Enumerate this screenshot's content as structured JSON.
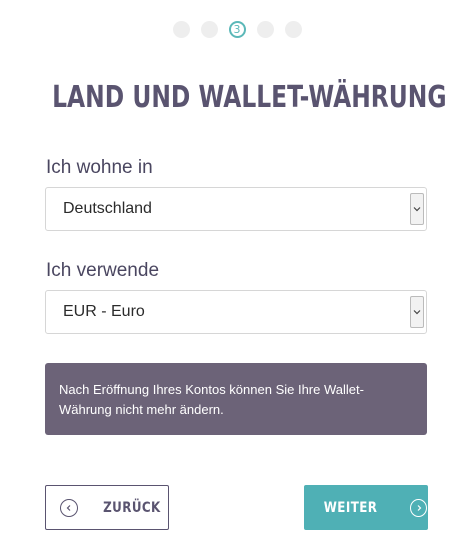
{
  "stepper": {
    "total_steps": 5,
    "current_step": 3,
    "current_label": "3",
    "active_color": "#5bb8b8"
  },
  "title": "LAND UND WALLET-WÄHRUNG",
  "country": {
    "label": "Ich wohne in",
    "selected": "Deutschland"
  },
  "currency": {
    "label": "Ich verwende",
    "selected": "EUR - Euro"
  },
  "notice": {
    "text": "Nach Eröffnung Ihres Kontos können Sie Ihre Wallet-Währung nicht mehr ändern."
  },
  "buttons": {
    "back_label": "ZURÜCK",
    "next_label": "WEITER"
  },
  "colors": {
    "title": "#5a5470",
    "notice_bg": "#6c6378",
    "next_bg": "#4fb0b5"
  },
  "icons": {
    "back": "chevron-left-circle-icon",
    "next": "chevron-right-circle-icon",
    "select_arrow": "chevron-down-icon"
  }
}
